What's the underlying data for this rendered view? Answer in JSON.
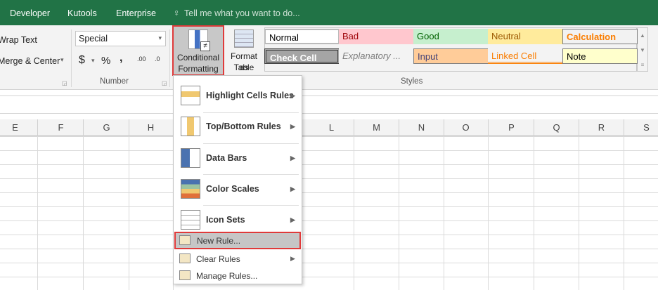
{
  "tabs": {
    "items": [
      "Developer",
      "Kutools",
      "Enterprise"
    ],
    "tell_me": "Tell me what you want to do..."
  },
  "alignment": {
    "wrap_text": "Wrap Text",
    "merge_center": "Merge & Center"
  },
  "number": {
    "format": "Special",
    "currency": "$",
    "percent": "%",
    "comma": ",",
    "inc_decimal": ".00",
    "dec_decimal": ".0",
    "group_label": "Number"
  },
  "buttons": {
    "conditional_formatting": [
      "Conditional",
      "Formatting"
    ],
    "format_as_table": [
      "Format as",
      "Table"
    ]
  },
  "styles": {
    "group_label": "Styles",
    "items": [
      {
        "label": "Normal",
        "bg": "#ffffff",
        "fg": "#000000"
      },
      {
        "label": "Bad",
        "bg": "#ffc7ce",
        "fg": "#9c0006"
      },
      {
        "label": "Good",
        "bg": "#c6efce",
        "fg": "#006100"
      },
      {
        "label": "Neutral",
        "bg": "#ffeb9c",
        "fg": "#9c5700"
      },
      {
        "label": "Calculation",
        "bg": "#f2f2f2",
        "fg": "#fa7d00"
      },
      {
        "label": "Check Cell",
        "bg": "#a5a5a5",
        "fg": "#ffffff"
      },
      {
        "label": "Explanatory ...",
        "bg": "#f3f3f3",
        "fg": "#7f7f7f"
      },
      {
        "label": "Input",
        "bg": "#ffcc99",
        "fg": "#3f3f76"
      },
      {
        "label": "Linked Cell",
        "bg": "#f3f3f3",
        "fg": "#fa7d00"
      },
      {
        "label": "Note",
        "bg": "#ffffcc",
        "fg": "#000000"
      }
    ]
  },
  "columns": [
    "E",
    "F",
    "G",
    "H",
    "L",
    "M",
    "N",
    "O",
    "P",
    "Q",
    "R",
    "S"
  ],
  "menu": {
    "items": [
      "Highlight Cells Rules",
      "Top/Bottom Rules",
      "Data Bars",
      "Color Scales",
      "Icon Sets"
    ],
    "new_rule": "New Rule...",
    "clear_rules": "Clear Rules",
    "manage_rules": "Manage Rules..."
  },
  "accent": "#217346",
  "highlight": "#e03a3a"
}
